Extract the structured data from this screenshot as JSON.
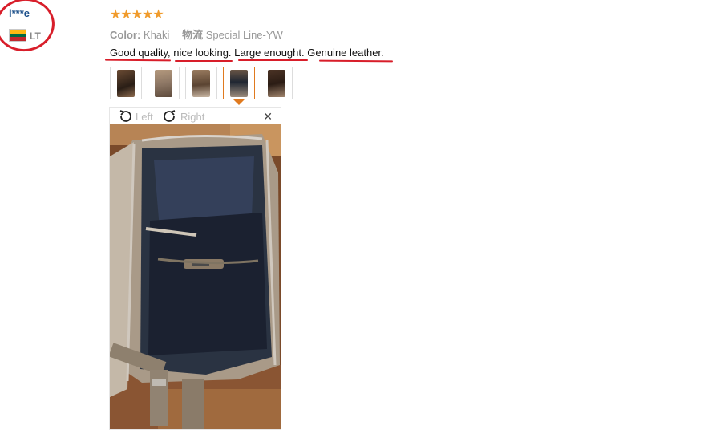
{
  "reviewer": {
    "name": "l***e",
    "country": "LT",
    "flag_icon": "lithuania-flag-icon",
    "flag_colors": [
      "#fdb913",
      "#006a44",
      "#c1272d"
    ]
  },
  "rating": {
    "stars": "★★★★★",
    "value": 5,
    "max": 5,
    "color": "#f09b2c"
  },
  "meta": {
    "color_label": "Color:",
    "color_value": "Khaki",
    "shipping_label": "物流",
    "shipping_value": "Special Line-YW"
  },
  "review": {
    "parts": [
      "Good quality",
      ", ",
      "nice looking",
      ". ",
      "Large enought",
      ". ",
      "Genuine leather",
      "."
    ]
  },
  "thumbnails": {
    "count": 5,
    "active_index": 3
  },
  "viewer": {
    "left_label": "Left",
    "right_label": "Right",
    "close_icon": "close-icon"
  },
  "colors": {
    "annotation_red": "#d81e2a",
    "name_blue": "#1a4e8a",
    "active_border": "#e07a1f"
  }
}
